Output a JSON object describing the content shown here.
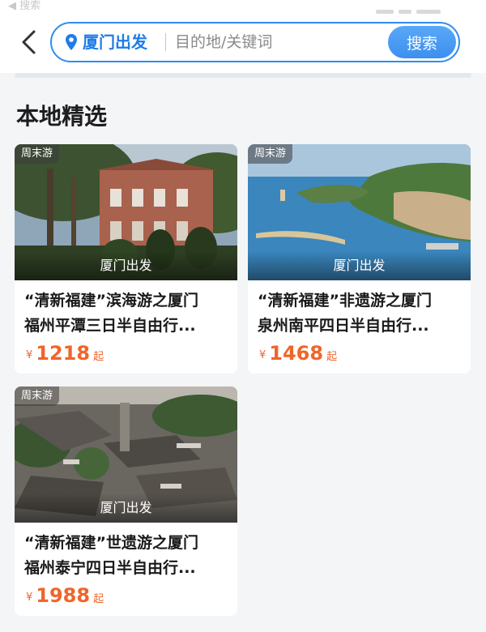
{
  "status_bar": {
    "back_app_label": "◀ 搜索"
  },
  "header": {
    "origin": "厦门出发",
    "search_placeholder": "目的地/关键词",
    "search_button": "搜索"
  },
  "section": {
    "title": "本地精选"
  },
  "cards": [
    {
      "tag": "周末游",
      "depart": "厦门出发",
      "title_line1": "“清新福建”滨海游之厦门",
      "title_line2": "福州平潭三日半自由行...",
      "currency": "¥",
      "price": "1218",
      "price_suffix": "起"
    },
    {
      "tag": "周末游",
      "depart": "厦门出发",
      "title_line1": "“清新福建”非遗游之厦门",
      "title_line2": "泉州南平四日半自由行...",
      "currency": "¥",
      "price": "1468",
      "price_suffix": "起"
    },
    {
      "tag": "周末游",
      "depart": "厦门出发",
      "title_line1": "“清新福建”世遗游之厦门",
      "title_line2": "福州泰宁四日半自由行...",
      "currency": "¥",
      "price": "1988",
      "price_suffix": "起"
    }
  ],
  "colors": {
    "accent_blue": "#2f8cf2",
    "price_orange": "#f0652a"
  },
  "icons": [
    "back-arrow-icon",
    "location-pin-icon"
  ]
}
